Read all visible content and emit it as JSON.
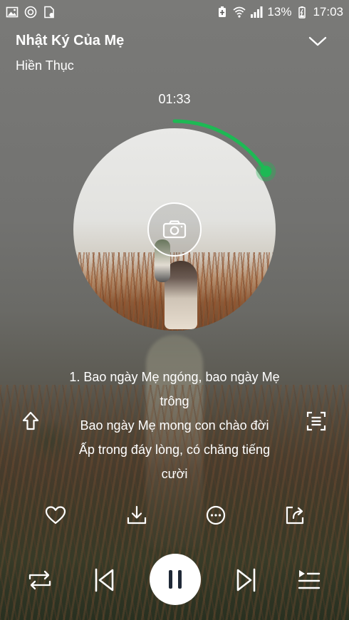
{
  "status_bar": {
    "battery": "13%",
    "time": "17:03",
    "icons_left": [
      "gallery-icon",
      "app-icon",
      "sim-card-icon"
    ],
    "icons_right": [
      "battery-saver-icon",
      "wifi-icon",
      "signal-icon",
      "battery-charging-icon"
    ]
  },
  "player": {
    "title": "Nhật Ký Của Mẹ",
    "artist": "Hiền Thục",
    "elapsed": "01:33",
    "progress_fraction": 0.16,
    "accent_color": "#1db954"
  },
  "lyrics": {
    "lines": [
      "1. Bao ngày Mẹ ngóng, bao ngày Mẹ",
      "trông",
      "Bao ngày Mẹ mong con chào đời",
      "Ấp trong đáy lòng, có chăng tiếng",
      "cười"
    ]
  },
  "actions": [
    "heart-icon",
    "download-icon",
    "more-icon",
    "share-icon"
  ],
  "controls": [
    "repeat-icon",
    "previous-icon",
    "pause-icon",
    "next-icon",
    "queue-icon"
  ]
}
